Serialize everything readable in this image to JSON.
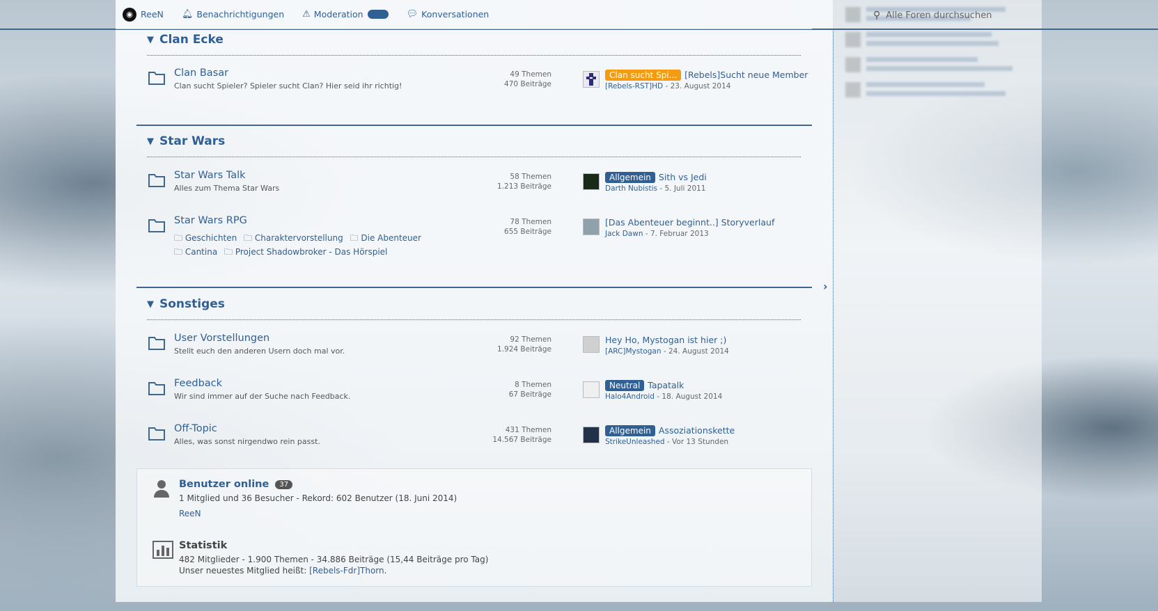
{
  "topbar": {
    "user": "ReeN",
    "notifications": "Benachrichtigungen",
    "moderation": "Moderation",
    "conversations": "Konversationen",
    "search_placeholder": "Alle Foren durchsuchen"
  },
  "categories": [
    {
      "title": "Clan Ecke",
      "forums": [
        {
          "name": "Clan Basar",
          "desc": "Clan sucht Spieler? Spieler sucht Clan? Hier seid ihr richtig!",
          "themen": "49 Themen",
          "beitraege": "470 Beiträge",
          "label": "Clan sucht Spi...",
          "label_color": "orange",
          "last_title": "[Rebels]Sucht neue Member",
          "last_user": "[Rebels-RST]HD",
          "last_date": " - 23. August 2014"
        }
      ]
    },
    {
      "title": "Star Wars",
      "forums": [
        {
          "name": "Star Wars Talk",
          "desc": "Alles zum Thema Star Wars",
          "themen": "58 Themen",
          "beitraege": "1.213 Beiträge",
          "label": "Allgemein",
          "label_color": "blue",
          "last_title": "Sith vs Jedi",
          "last_user": "Darth Nubistis",
          "last_date": " - 5. Juli 2011"
        },
        {
          "name": "Star Wars RPG",
          "subforums": [
            "Geschichten",
            "Charaktervorstellung",
            "Die Abenteuer",
            "Cantina",
            "Project Shadowbroker - Das Hörspiel"
          ],
          "themen": "78 Themen",
          "beitraege": "655 Beiträge",
          "last_title": "[Das Abenteuer beginnt..] Storyverlauf",
          "last_user": "Jack Dawn",
          "last_date": " - 7. Februar 2013"
        }
      ]
    },
    {
      "title": "Sonstiges",
      "forums": [
        {
          "name": "User Vorstellungen",
          "desc": "Stellt euch den anderen Usern doch mal vor.",
          "themen": "92 Themen",
          "beitraege": "1.924 Beiträge",
          "last_title": "Hey Ho, Mystogan ist hier ;)",
          "last_user": "[ARC]Mystogan",
          "last_date": " - 24. August 2014"
        },
        {
          "name": "Feedback",
          "desc": "Wir sind immer auf der Suche nach Feedback.",
          "themen": "8 Themen",
          "beitraege": "67 Beiträge",
          "label": "Neutral",
          "label_color": "blue",
          "last_title": "Tapatalk",
          "last_user": "Halo4Android",
          "last_date": " - 18. August 2014"
        },
        {
          "name": "Off-Topic",
          "desc": "Alles, was sonst nirgendwo rein passt.",
          "themen": "431 Themen",
          "beitraege": "14.567 Beiträge",
          "label": "Allgemein",
          "label_color": "blue",
          "last_title": "Assoziationskette",
          "last_user": "StrikeUnleashed",
          "last_date": " - Vor 13 Stunden"
        }
      ]
    }
  ],
  "online": {
    "title": "Benutzer online",
    "count": "37",
    "text": "1 Mitglied und 36 Besucher - Rekord: 602 Benutzer (18. Juni 2014)",
    "users": "ReeN"
  },
  "stats": {
    "title": "Statistik",
    "text": "482 Mitglieder - 1.900 Themen - 34.886 Beiträge (15,44 Beiträge pro Tag)",
    "newest_prefix": "Unser neuestes Mitglied heißt: ",
    "newest_user": "[Rebels-Fdr]Thorn",
    "newest_suffix": "."
  },
  "colors": {
    "accent": "#2f5f93",
    "label_orange": "#f39c12",
    "label_blue": "#2f5f93"
  }
}
